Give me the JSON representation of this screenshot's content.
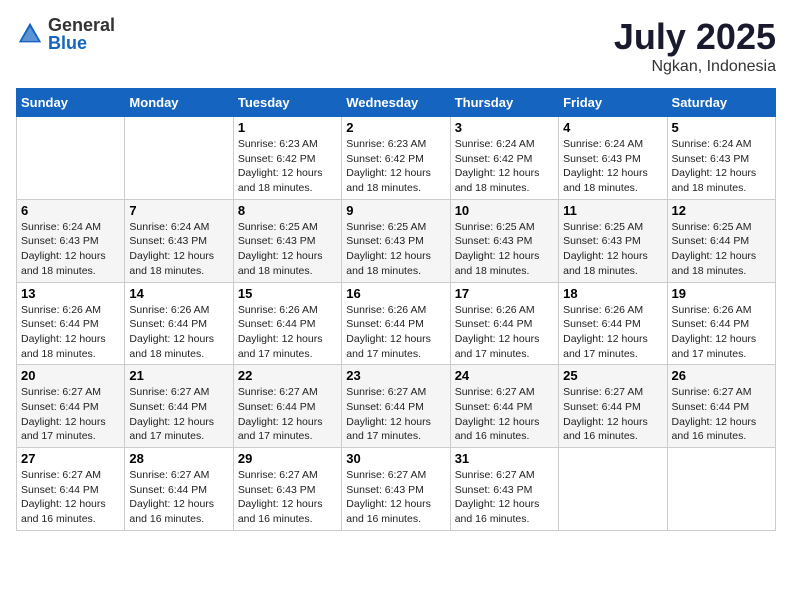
{
  "logo": {
    "general": "General",
    "blue": "Blue"
  },
  "title": {
    "month": "July 2025",
    "location": "Ngkan, Indonesia"
  },
  "headers": [
    "Sunday",
    "Monday",
    "Tuesday",
    "Wednesday",
    "Thursday",
    "Friday",
    "Saturday"
  ],
  "weeks": [
    [
      {
        "day": "",
        "info": ""
      },
      {
        "day": "",
        "info": ""
      },
      {
        "day": "1",
        "info": "Sunrise: 6:23 AM\nSunset: 6:42 PM\nDaylight: 12 hours and 18 minutes."
      },
      {
        "day": "2",
        "info": "Sunrise: 6:23 AM\nSunset: 6:42 PM\nDaylight: 12 hours and 18 minutes."
      },
      {
        "day": "3",
        "info": "Sunrise: 6:24 AM\nSunset: 6:42 PM\nDaylight: 12 hours and 18 minutes."
      },
      {
        "day": "4",
        "info": "Sunrise: 6:24 AM\nSunset: 6:43 PM\nDaylight: 12 hours and 18 minutes."
      },
      {
        "day": "5",
        "info": "Sunrise: 6:24 AM\nSunset: 6:43 PM\nDaylight: 12 hours and 18 minutes."
      }
    ],
    [
      {
        "day": "6",
        "info": "Sunrise: 6:24 AM\nSunset: 6:43 PM\nDaylight: 12 hours and 18 minutes."
      },
      {
        "day": "7",
        "info": "Sunrise: 6:24 AM\nSunset: 6:43 PM\nDaylight: 12 hours and 18 minutes."
      },
      {
        "day": "8",
        "info": "Sunrise: 6:25 AM\nSunset: 6:43 PM\nDaylight: 12 hours and 18 minutes."
      },
      {
        "day": "9",
        "info": "Sunrise: 6:25 AM\nSunset: 6:43 PM\nDaylight: 12 hours and 18 minutes."
      },
      {
        "day": "10",
        "info": "Sunrise: 6:25 AM\nSunset: 6:43 PM\nDaylight: 12 hours and 18 minutes."
      },
      {
        "day": "11",
        "info": "Sunrise: 6:25 AM\nSunset: 6:43 PM\nDaylight: 12 hours and 18 minutes."
      },
      {
        "day": "12",
        "info": "Sunrise: 6:25 AM\nSunset: 6:44 PM\nDaylight: 12 hours and 18 minutes."
      }
    ],
    [
      {
        "day": "13",
        "info": "Sunrise: 6:26 AM\nSunset: 6:44 PM\nDaylight: 12 hours and 18 minutes."
      },
      {
        "day": "14",
        "info": "Sunrise: 6:26 AM\nSunset: 6:44 PM\nDaylight: 12 hours and 18 minutes."
      },
      {
        "day": "15",
        "info": "Sunrise: 6:26 AM\nSunset: 6:44 PM\nDaylight: 12 hours and 17 minutes."
      },
      {
        "day": "16",
        "info": "Sunrise: 6:26 AM\nSunset: 6:44 PM\nDaylight: 12 hours and 17 minutes."
      },
      {
        "day": "17",
        "info": "Sunrise: 6:26 AM\nSunset: 6:44 PM\nDaylight: 12 hours and 17 minutes."
      },
      {
        "day": "18",
        "info": "Sunrise: 6:26 AM\nSunset: 6:44 PM\nDaylight: 12 hours and 17 minutes."
      },
      {
        "day": "19",
        "info": "Sunrise: 6:26 AM\nSunset: 6:44 PM\nDaylight: 12 hours and 17 minutes."
      }
    ],
    [
      {
        "day": "20",
        "info": "Sunrise: 6:27 AM\nSunset: 6:44 PM\nDaylight: 12 hours and 17 minutes."
      },
      {
        "day": "21",
        "info": "Sunrise: 6:27 AM\nSunset: 6:44 PM\nDaylight: 12 hours and 17 minutes."
      },
      {
        "day": "22",
        "info": "Sunrise: 6:27 AM\nSunset: 6:44 PM\nDaylight: 12 hours and 17 minutes."
      },
      {
        "day": "23",
        "info": "Sunrise: 6:27 AM\nSunset: 6:44 PM\nDaylight: 12 hours and 17 minutes."
      },
      {
        "day": "24",
        "info": "Sunrise: 6:27 AM\nSunset: 6:44 PM\nDaylight: 12 hours and 16 minutes."
      },
      {
        "day": "25",
        "info": "Sunrise: 6:27 AM\nSunset: 6:44 PM\nDaylight: 12 hours and 16 minutes."
      },
      {
        "day": "26",
        "info": "Sunrise: 6:27 AM\nSunset: 6:44 PM\nDaylight: 12 hours and 16 minutes."
      }
    ],
    [
      {
        "day": "27",
        "info": "Sunrise: 6:27 AM\nSunset: 6:44 PM\nDaylight: 12 hours and 16 minutes."
      },
      {
        "day": "28",
        "info": "Sunrise: 6:27 AM\nSunset: 6:44 PM\nDaylight: 12 hours and 16 minutes."
      },
      {
        "day": "29",
        "info": "Sunrise: 6:27 AM\nSunset: 6:43 PM\nDaylight: 12 hours and 16 minutes."
      },
      {
        "day": "30",
        "info": "Sunrise: 6:27 AM\nSunset: 6:43 PM\nDaylight: 12 hours and 16 minutes."
      },
      {
        "day": "31",
        "info": "Sunrise: 6:27 AM\nSunset: 6:43 PM\nDaylight: 12 hours and 16 minutes."
      },
      {
        "day": "",
        "info": ""
      },
      {
        "day": "",
        "info": ""
      }
    ]
  ]
}
